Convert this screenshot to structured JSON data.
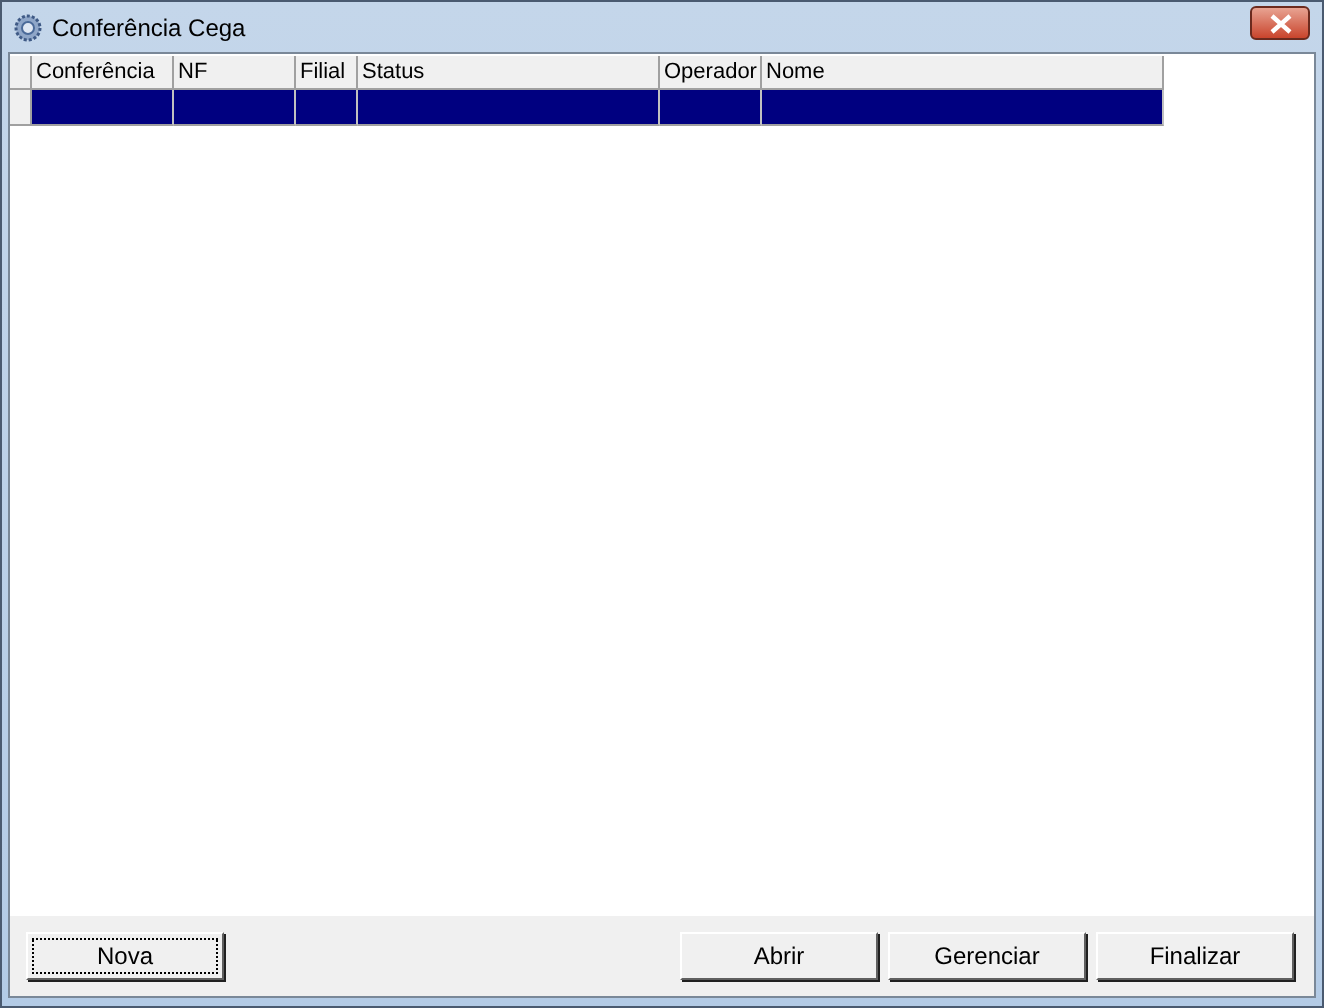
{
  "window": {
    "title": "Conferência Cega"
  },
  "table": {
    "columns": [
      "Conferência",
      "NF",
      "Filial",
      "Status",
      "Operador",
      "Nome"
    ],
    "rows": [
      {
        "selected": true
      }
    ]
  },
  "buttons_left": [
    {
      "label": "Nova",
      "focused": true
    }
  ],
  "buttons_right": [
    {
      "label": "Abrir",
      "focused": false
    },
    {
      "label": "Gerenciar",
      "focused": false
    },
    {
      "label": "Finalizar",
      "focused": false
    }
  ]
}
